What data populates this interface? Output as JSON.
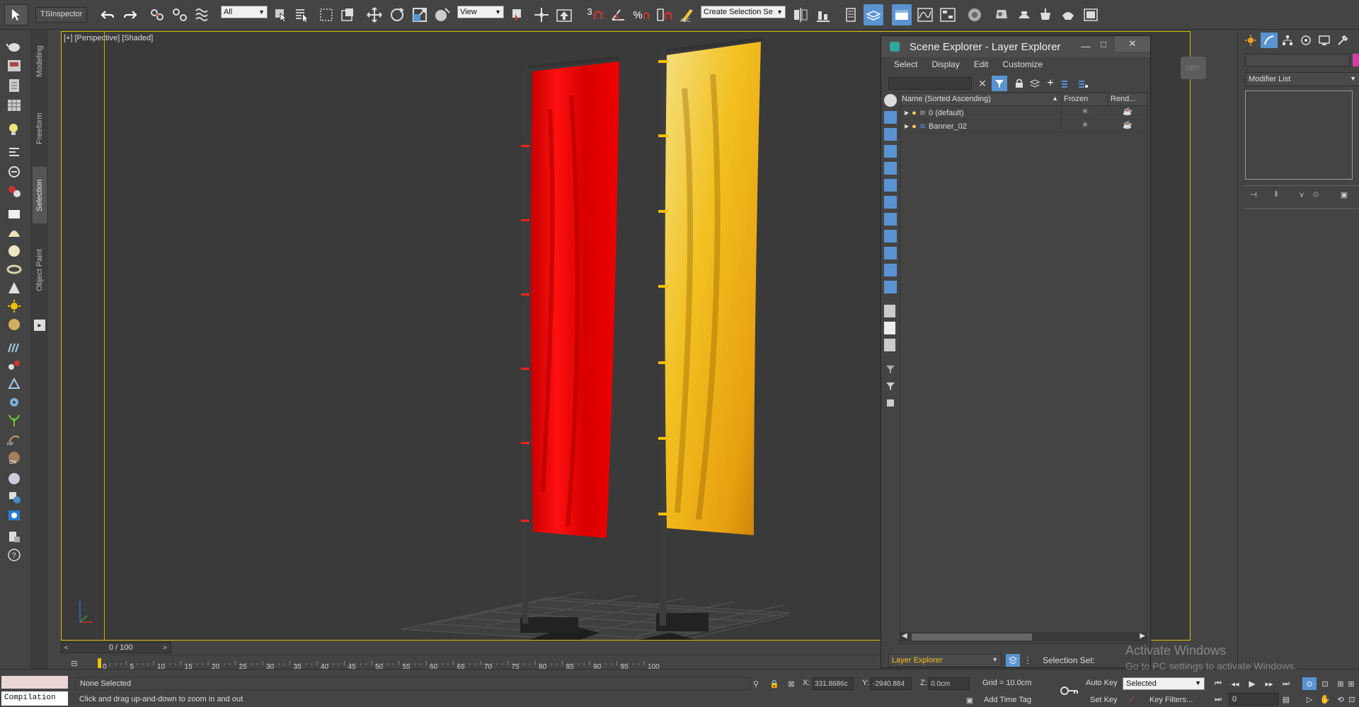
{
  "toolbar": {
    "inspector_label": "TSInspector",
    "filter_select": "All",
    "reference_coord_select": "View",
    "create_selection_set": "Create Selection Se",
    "snap_label": "3"
  },
  "ribbon_tabs": [
    "Modeling",
    "Freeform",
    "Selection",
    "Object Paint"
  ],
  "viewport": {
    "label": "[+] [Perspective] [Shaded]",
    "viewcube_label": "LEFT"
  },
  "scene_explorer": {
    "title": "Scene Explorer - Layer Explorer",
    "menu": [
      "Select",
      "Display",
      "Edit",
      "Customize"
    ],
    "columns": [
      "Name (Sorted Ascending)",
      "Frozen",
      "Rend..."
    ],
    "rows": [
      {
        "name": "0 (default)"
      },
      {
        "name": "Banner_02"
      }
    ],
    "footer_select": "Layer Explorer",
    "selection_set_label": "Selection Set:"
  },
  "right_panel": {
    "modifier_list": "Modifier List"
  },
  "timeline": {
    "frame_counter": "0 / 100",
    "ticks": [
      "0",
      "5",
      "10",
      "15",
      "20",
      "25",
      "30",
      "35",
      "40",
      "45",
      "50",
      "55",
      "60",
      "65",
      "70",
      "75",
      "80",
      "85",
      "90",
      "95",
      "100"
    ]
  },
  "status": {
    "maxscript": "Compilation",
    "selection": "None Selected",
    "prompt": "Click and drag up-and-down to zoom in and out",
    "x_label": "X:",
    "x_value": "331.8686c",
    "y_label": "Y:",
    "y_value": "-2940.884",
    "z_label": "Z:",
    "z_value": "0.0cm",
    "grid": "Grid = 10.0cm",
    "add_time_tag": "Add Time Tag",
    "auto_key": "Auto Key",
    "auto_key_select": "Selected",
    "set_key": "Set Key",
    "key_filters": "Key Filters...",
    "frame_input": "0"
  },
  "watermark": {
    "line1": "Activate Windows",
    "line2": "Go to PC settings to activate Windows."
  },
  "colors": {
    "viewport_border": "#d8c000",
    "red_banner": "#e00000",
    "yellow_banner": "#f0b020",
    "accent": "#5a93d1"
  }
}
